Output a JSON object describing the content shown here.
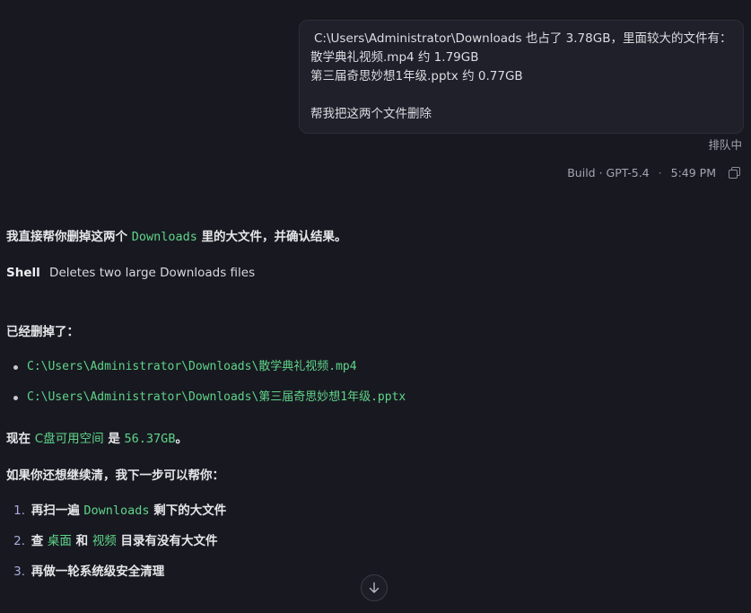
{
  "user_message": {
    "line1": "C:\\Users\\Administrator\\Downloads 也占了 3.78GB，里面较大的文件有：",
    "line2": "散学典礼视频.mp4 约 1.79GB",
    "line3": "第三届奇思妙想1年级.pptx 约 0.77GB",
    "line4": "帮我把这两个文件删除"
  },
  "queue_status": "排队中",
  "meta": {
    "mode": "Build · GPT-5.4",
    "separator": "·",
    "time": "5:49 PM",
    "copy_icon": "copy-icon"
  },
  "assistant": {
    "intro_pre": "我直接帮你删掉这两个 ",
    "intro_code": "Downloads",
    "intro_post": " 里的大文件，并确认结果。",
    "shell_tool": "Shell",
    "shell_desc": "Deletes two large Downloads files",
    "deleted_heading": "已经删掉了：",
    "deleted_files": [
      "C:\\Users\\Administrator\\Downloads\\散学典礼视频.mp4",
      "C:\\Users\\Administrator\\Downloads\\第三届奇思妙想1年级.pptx"
    ],
    "space_pre": "现在 ",
    "space_drive": "C盘可用空间",
    "space_mid": " 是 ",
    "space_value": "56.37GB",
    "space_post": "。",
    "next_heading": "如果你还想继续清，我下一步可以帮你：",
    "next_steps": [
      {
        "num": "1.",
        "pre": "再扫一遍 ",
        "code": "Downloads",
        "post": " 剩下的大文件"
      },
      {
        "num": "2.",
        "pre": "查 ",
        "code": "桌面",
        "mid": " 和 ",
        "code2": "视频",
        "post": " 目录有没有大文件"
      },
      {
        "num": "3.",
        "pre": "再做一轮系统级安全清理"
      }
    ]
  },
  "scroll_button_icon": "arrow-down-icon",
  "colors": {
    "background": "#181920",
    "bubble": "#1f2029",
    "code_green": "#5fd48a",
    "muted": "#a4a5b0",
    "list_number": "#a9aae0"
  }
}
